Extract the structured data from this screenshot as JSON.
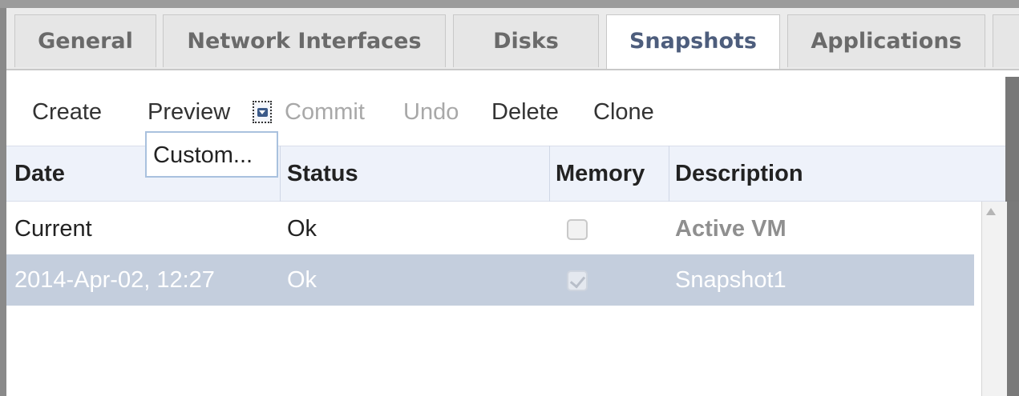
{
  "tabs": [
    {
      "label": "General"
    },
    {
      "label": "Network Interfaces"
    },
    {
      "label": "Disks"
    },
    {
      "label": "Snapshots"
    },
    {
      "label": "Applications"
    }
  ],
  "active_tab": "Snapshots",
  "toolbar": {
    "create": "Create",
    "preview": "Preview",
    "commit": "Commit",
    "undo": "Undo",
    "delete": "Delete",
    "clone": "Clone"
  },
  "preview_menu": {
    "items": [
      "Custom..."
    ]
  },
  "table": {
    "columns": [
      "Date",
      "Status",
      "Memory",
      "Description"
    ],
    "rows": [
      {
        "date": "Current",
        "status": "Ok",
        "memory": false,
        "description": "Active VM"
      },
      {
        "date": "2014-Apr-02, 12:27",
        "status": "Ok",
        "memory": true,
        "description": "Snapshot1"
      }
    ]
  },
  "colors": {
    "active_tab_text": "#4d5d7c",
    "selected_row": "#c4cedd",
    "header_bg": "#eef2fa"
  }
}
